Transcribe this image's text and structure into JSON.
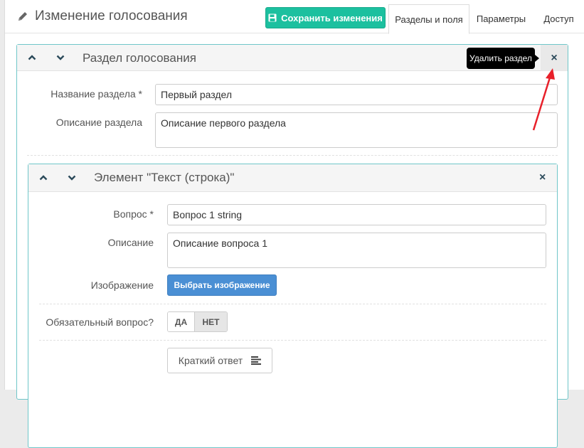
{
  "header": {
    "title": "Изменение голосования",
    "save_label": "Сохранить изменения",
    "tabs": [
      {
        "label": "Разделы и поля",
        "active": true
      },
      {
        "label": "Параметры",
        "active": false
      },
      {
        "label": "Доступ",
        "active": false
      }
    ]
  },
  "section": {
    "title": "Раздел голосования",
    "tooltip": "Удалить раздел",
    "close_glyph": "×",
    "name_label": "Название раздела *",
    "name_value": "Первый раздел",
    "desc_label": "Описание раздела",
    "desc_value": "Описание первого раздела"
  },
  "element": {
    "title": "Элемент \"Текст (строка)\"",
    "close_glyph": "×",
    "question_label": "Вопрос *",
    "question_value": "Вопрос 1 string",
    "desc_label": "Описание",
    "desc_value": "Описание вопроса 1",
    "image_label": "Изображение",
    "image_button": "Выбрать изображение",
    "required_label": "Обязательный вопрос?",
    "required_yes": "ДА",
    "required_no": "НЕТ",
    "required_selected": "НЕТ",
    "short_answer_label": "Краткий ответ"
  },
  "colors": {
    "accent_green": "#1cc09f",
    "accent_blue": "#4a8fd4",
    "panel_border": "#6fc6c9",
    "annotation_arrow": "#e8202a"
  },
  "icons": [
    "pencil-icon",
    "save-icon",
    "chevron-up-icon",
    "chevron-down-icon",
    "close-icon",
    "text-lines-icon"
  ]
}
